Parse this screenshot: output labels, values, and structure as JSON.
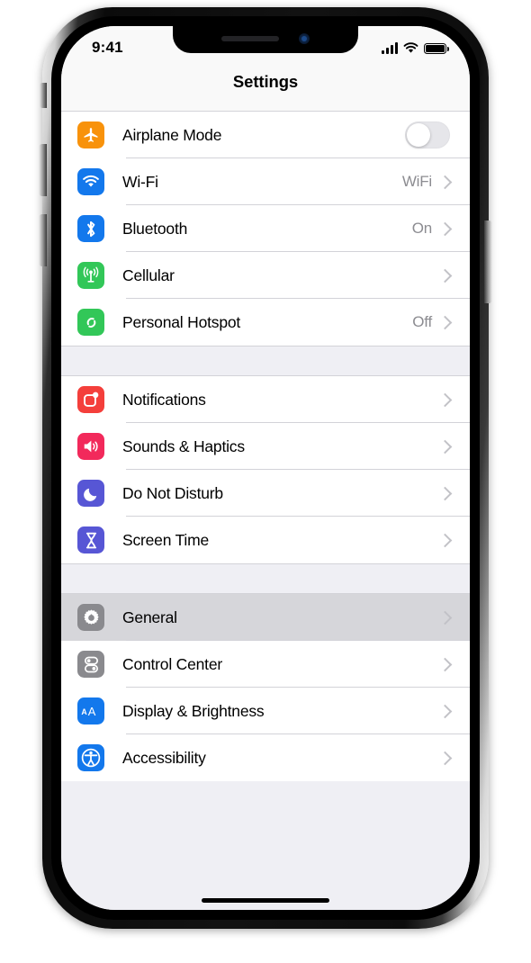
{
  "status_bar": {
    "time": "9:41",
    "signal_icon": "cellular-signal-icon",
    "signal_bars_filled": 4,
    "wifi_icon": "wifi-icon",
    "battery_icon": "battery-icon",
    "battery_level_percent": 100
  },
  "nav": {
    "title": "Settings"
  },
  "sections": [
    {
      "rows": [
        {
          "label": "Airplane Mode",
          "icon": "airplane-icon",
          "icon_color": "#F8920B",
          "control": "toggle",
          "toggle_on": false,
          "value": ""
        },
        {
          "label": "Wi-Fi",
          "icon": "wifi-icon",
          "icon_color": "#1378EC",
          "control": "chevron",
          "value": "WiFi"
        },
        {
          "label": "Bluetooth",
          "icon": "bluetooth-icon",
          "icon_color": "#1378EC",
          "control": "chevron",
          "value": "On"
        },
        {
          "label": "Cellular",
          "icon": "cellular-antenna-icon",
          "icon_color": "#32C758",
          "control": "chevron",
          "value": ""
        },
        {
          "label": "Personal Hotspot",
          "icon": "personal-hotspot-icon",
          "icon_color": "#32C758",
          "control": "chevron",
          "value": ""
        }
      ]
    },
    {
      "rows": [
        {
          "label": "Notifications",
          "icon": "notifications-icon",
          "icon_color": "#F43F3B",
          "control": "chevron",
          "value": ""
        },
        {
          "label": "Sounds & Haptics",
          "icon": "sounds-haptics-icon",
          "icon_color": "#F2295B",
          "control": "chevron",
          "value": ""
        },
        {
          "label": "Do Not Disturb",
          "icon": "moon-icon",
          "icon_color": "#5756D5",
          "control": "chevron",
          "value": ""
        },
        {
          "label": "Screen Time",
          "icon": "hourglass-icon",
          "icon_color": "#5756D5",
          "control": "chevron",
          "value": ""
        }
      ]
    },
    {
      "rows": [
        {
          "label": "General",
          "icon": "gear-icon",
          "icon_color": "#8A8A8E",
          "control": "chevron",
          "value": "",
          "highlighted": true
        },
        {
          "label": "Control Center",
          "icon": "control-center-icon",
          "icon_color": "#8A8A8E",
          "control": "chevron",
          "value": ""
        },
        {
          "label": "Display & Brightness",
          "icon": "display-brightness-icon",
          "icon_color": "#1378EC",
          "control": "chevron",
          "value": ""
        },
        {
          "label": "Accessibility",
          "icon": "accessibility-icon",
          "icon_color": "#1378EC",
          "control": "chevron",
          "value": ""
        }
      ]
    }
  ],
  "hotspot_value_note": "Off",
  "personal_hotspot_value": "Off",
  "home_indicator": "home-indicator",
  "hardware": {
    "silent_switch": "silent-switch",
    "volume_up": "volume-up-button",
    "volume_down": "volume-down-button",
    "side_button": "side-button"
  },
  "colors": {
    "list_background": "#EFEFF4",
    "row_background": "#FFFFFF",
    "separator": "#D3D3D8",
    "highlight": "#D6D6DA",
    "value_text": "#8C8C91",
    "chevron": "#C2C2C7"
  }
}
